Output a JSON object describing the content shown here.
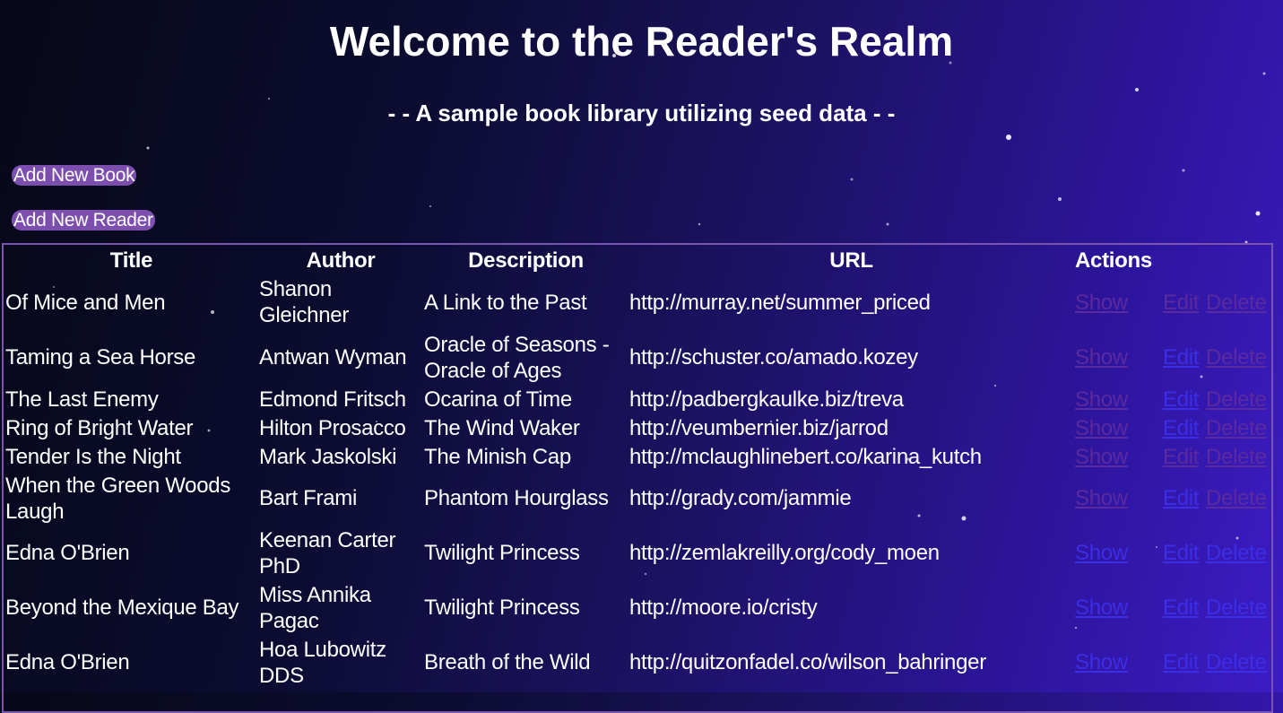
{
  "page": {
    "title": "Welcome to the Reader's Realm",
    "subtitle": "- - A sample book library utilizing seed data - -"
  },
  "buttons": {
    "add_book": "Add New Book",
    "add_reader": "Add New Reader"
  },
  "table": {
    "headers": [
      "Title",
      "Author",
      "Description",
      "URL",
      "Actions"
    ],
    "action_labels": {
      "show": "Show",
      "edit": "Edit",
      "delete": "Delete"
    },
    "rows": [
      {
        "title": "Of Mice and Men",
        "author": "Shanon Gleichner",
        "description": "A Link to the Past",
        "url": "http://murray.net/summer_priced"
      },
      {
        "title": "Taming a Sea Horse",
        "author": "Antwan Wyman",
        "description": "Oracle of Seasons - Oracle of Ages",
        "url": "http://schuster.co/amado.kozey"
      },
      {
        "title": "The Last Enemy",
        "author": "Edmond Fritsch",
        "description": "Ocarina of Time",
        "url": "http://padbergkaulke.biz/treva"
      },
      {
        "title": "Ring of Bright Water",
        "author": "Hilton Prosacco",
        "description": "The Wind Waker",
        "url": "http://veumbernier.biz/jarrod"
      },
      {
        "title": "Tender Is the Night",
        "author": "Mark Jaskolski",
        "description": "The Minish Cap",
        "url": "http://mclaughlinebert.co/karina_kutch"
      },
      {
        "title": "When the Green Woods Laugh",
        "author": "Bart Frami",
        "description": "Phantom Hourglass",
        "url": "http://grady.com/jammie"
      },
      {
        "title": "Edna O'Brien",
        "author": "Keenan Carter PhD",
        "description": "Twilight Princess",
        "url": "http://zemlakreilly.org/cody_moen"
      },
      {
        "title": "Beyond the Mexique Bay",
        "author": "Miss Annika Pagac",
        "description": "Twilight Princess",
        "url": "http://moore.io/cristy"
      },
      {
        "title": "Edna O'Brien",
        "author": "Hoa Lubowitz DDS",
        "description": "Breath of the Wild",
        "url": "http://quitzonfadel.co/wilson_bahringer"
      }
    ]
  },
  "colors": {
    "button_bg": "#7c4fae",
    "table_border": "#7a55b0",
    "link_visited": "#5a2a9e",
    "link_unvisited": "#3c2ee6"
  }
}
